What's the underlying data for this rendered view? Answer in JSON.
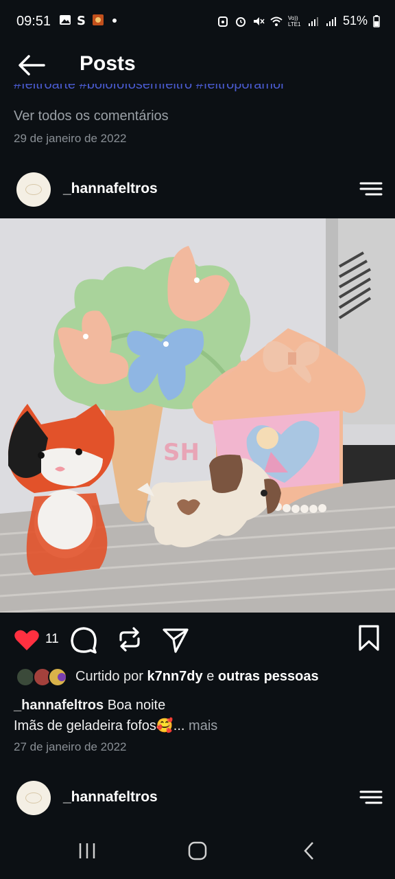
{
  "status_bar": {
    "time": "09:51",
    "battery": "51%",
    "left_icons": [
      "gallery-icon",
      "s-app-icon",
      "app-thumbnail-icon",
      "dot-icon"
    ],
    "right_icons": [
      "sync-icon",
      "alarm-icon",
      "mute-icon",
      "wifi-icon",
      "volte-icon",
      "signal-icon",
      "signal-icon",
      "battery-icon"
    ],
    "volte_label": "Vo)) LTE1"
  },
  "header": {
    "title": "Posts"
  },
  "previous_post": {
    "hashtags": "#feltroarte #bolofofosemfeltro #feltroporamor",
    "view_comments": "Ver todos os comentários",
    "date": "29 de janeiro de 2022"
  },
  "post": {
    "username": "_hannafeltros",
    "like_count": "11",
    "liked_by_prefix": "Curtido por",
    "liked_by_user": "k7nn7dy",
    "liked_by_connector": "e",
    "liked_by_suffix": "outras pessoas",
    "caption_user": "_hannafeltros",
    "caption_line1": "Boa noite",
    "caption_line2": "Imãs de geladeira fofos🥰...",
    "caption_more": "mais",
    "date": "27 de janeiro de 2022",
    "photo_label": "SH"
  },
  "next_post": {
    "username": "_hannafeltros"
  },
  "colors": {
    "background": "#0c1014",
    "like_red": "#ff3040",
    "hashtag_blue": "#4a5bd0",
    "secondary_text": "#9aa0a6"
  }
}
